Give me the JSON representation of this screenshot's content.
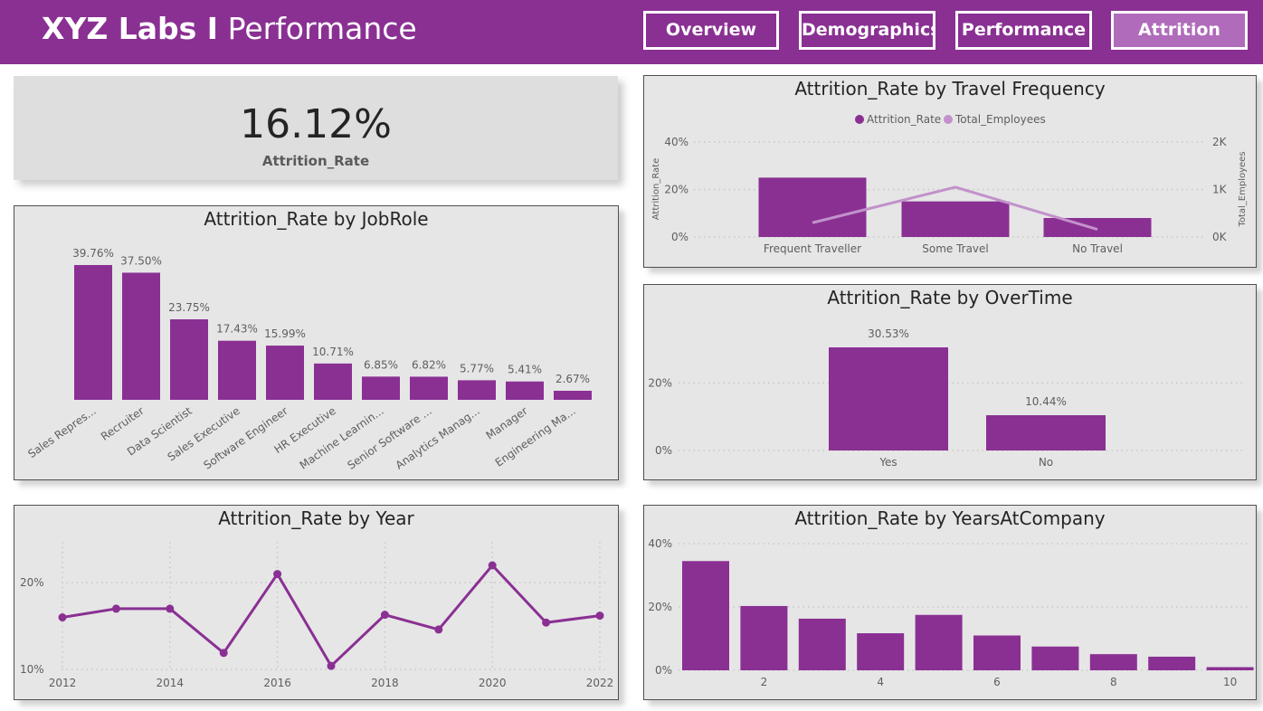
{
  "header": {
    "brand_bold": "XYZ Labs I",
    "brand_light": "Performance",
    "nav": [
      "Overview",
      "Demographics",
      "Performance",
      "Attrition"
    ],
    "active_nav": "Attrition"
  },
  "colors": {
    "header_bg": "#8a3093",
    "bar": "#8a3093",
    "line_secondary": "#c291cb",
    "card_bg": "#e6e6e6"
  },
  "kpi": {
    "value": "16.12%",
    "label": "Attrition_Rate"
  },
  "chart_data": [
    {
      "id": "jobrole",
      "type": "bar",
      "title": "Attrition_Rate by JobRole",
      "categories": [
        "Sales Repres...",
        "Recruiter",
        "Data Scientist",
        "Sales Executive",
        "Software Engineer",
        "HR Executive",
        "Machine Learnin...",
        "Senior Software ...",
        "Analytics Manag...",
        "Manager",
        "Engineering Ma..."
      ],
      "values": [
        39.76,
        37.5,
        23.75,
        17.43,
        15.99,
        10.71,
        6.85,
        6.82,
        5.77,
        5.41,
        2.67
      ],
      "labels": [
        "39.76%",
        "37.50%",
        "23.75%",
        "17.43%",
        "15.99%",
        "10.71%",
        "6.85%",
        "6.82%",
        "5.77%",
        "5.41%",
        "2.67%"
      ],
      "unit": "%"
    },
    {
      "id": "travel",
      "type": "bar",
      "title": "Attrition_Rate by Travel Frequency",
      "categories": [
        "Frequent Traveller",
        "Some Travel",
        "No Travel"
      ],
      "series": [
        {
          "name": "Attrition_Rate",
          "values": [
            25,
            15,
            8
          ],
          "axis": "left",
          "kind": "bar"
        },
        {
          "name": "Total_Employees",
          "values": [
            300,
            1050,
            160
          ],
          "axis": "right",
          "kind": "line"
        }
      ],
      "ylabel": "Attrition_Rate",
      "y2label": "Total_Employees",
      "ylim": [
        0,
        40
      ],
      "y2lim": [
        0,
        2000
      ],
      "yticks": [
        "0%",
        "20%",
        "40%"
      ],
      "y2ticks": [
        "0K",
        "1K",
        "2K"
      ],
      "legend": "top-center",
      "grid": true
    },
    {
      "id": "overtime",
      "type": "bar",
      "title": "Attrition_Rate by OverTime",
      "categories": [
        "Yes",
        "No"
      ],
      "values": [
        30.53,
        10.44
      ],
      "labels": [
        "30.53%",
        "10.44%"
      ],
      "ylim": [
        0,
        35
      ],
      "yticks": [
        "0%",
        "20%"
      ],
      "grid": true
    },
    {
      "id": "year",
      "type": "line",
      "title": "Attrition_Rate by Year",
      "x": [
        2012,
        2013,
        2014,
        2015,
        2016,
        2017,
        2018,
        2019,
        2020,
        2021,
        2022
      ],
      "values": [
        16.0,
        17.0,
        17.0,
        11.9,
        21.0,
        10.4,
        16.3,
        14.6,
        22.0,
        15.4,
        16.2
      ],
      "xticks": [
        "2012",
        "2014",
        "2016",
        "2018",
        "2020",
        "2022"
      ],
      "ylim": [
        10,
        22
      ],
      "yticks": [
        "10%",
        "20%"
      ],
      "grid": true
    },
    {
      "id": "years_at_company",
      "type": "bar",
      "title": "Attrition_Rate by YearsAtCompany",
      "x": [
        1,
        2,
        3,
        4,
        5,
        6,
        7,
        8,
        9,
        10
      ],
      "values": [
        34.5,
        20.3,
        16.3,
        11.7,
        17.5,
        11.0,
        7.5,
        5.1,
        4.3,
        1.0
      ],
      "xticks": [
        "2",
        "4",
        "6",
        "8",
        "10"
      ],
      "ylim": [
        0,
        40
      ],
      "yticks": [
        "0%",
        "20%",
        "40%"
      ],
      "grid": true
    }
  ]
}
